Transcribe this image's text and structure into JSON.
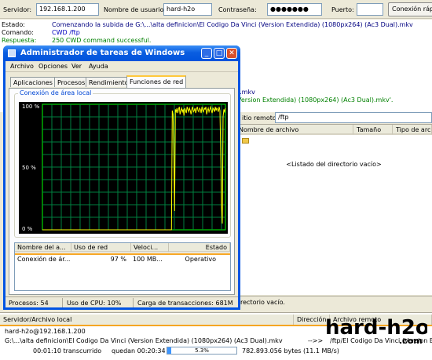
{
  "quickconnect": {
    "server_label": "Servidor:",
    "server_value": "192.168.1.200",
    "user_label": "Nombre de usuario:",
    "user_value": "hard-h2o",
    "password_label": "Contraseña:",
    "password_value": "●●●●●●●",
    "port_label": "Puerto:",
    "port_value": "",
    "connect_button": "Conexión rápida"
  },
  "log": [
    {
      "key": "Estado:",
      "text": "Comenzando la subida de G:\\...\\alta definicion\\El Codigo Da Vinci (Version Extendida) (1080px264) (Ac3 Dual).mkv",
      "kind": "status"
    },
    {
      "key": "Comando:",
      "text": "CWD /ftp",
      "kind": "command"
    },
    {
      "key": "Respuesta:",
      "text": "250 CWD command successful.",
      "kind": "response"
    },
    {
      "key": "",
      "text": ").mkv",
      "kind": "status"
    },
    {
      "key": "",
      "text": "Version Extendida) (1080px264) (Ac3 Dual).mkv'.",
      "kind": "response"
    }
  ],
  "remote": {
    "path_label": "itio remoto:",
    "path_value": "/ftp",
    "columns": [
      "Nombre de archivo",
      "Tamaño",
      "Tipo de archivo"
    ],
    "empty_message": "<Listado del directorio vacío>",
    "status": "rectorio vacío."
  },
  "taskmanager": {
    "title": "Administrador de tareas de Windows",
    "menu": [
      "Archivo",
      "Opciones",
      "Ver",
      "Ayuda"
    ],
    "tabs": [
      "Aplicaciones",
      "Procesos",
      "Rendimiento",
      "Funciones de red"
    ],
    "active_tab": "Funciones de red",
    "group_label": "Conexión de área local",
    "y_labels": [
      "100 %",
      "50 %",
      "0 %"
    ],
    "table_columns": [
      "Nombre del a...",
      "Uso de red",
      "Veloci...",
      "Estado"
    ],
    "table_row": [
      "Conexión de ár...",
      "97 %",
      "100 MB...",
      "Operativo"
    ],
    "status": {
      "processes": "Procesos: 54",
      "cpu": "Uso de CPU: 10%",
      "commit": "Carga de transacciones: 681M"
    }
  },
  "queue": {
    "columns": [
      "Servidor/Archivo local",
      "Dirección",
      "Archivo remoto"
    ],
    "server_row": "hard-h2o@192.168.1.200",
    "file_row": "G:\\...\\alta definicion\\El Codigo Da Vinci (Version Extendida) (1080px264) (Ac3 Dual).mkv",
    "direction": "-->>",
    "remote_file": "/ftp/El Codigo Da Vinci (Version E",
    "elapsed": "00:01:10 transcurrido",
    "remaining": "quedan 00:20:34",
    "progress_label": "5.3%",
    "progress": 0.053,
    "bytes": "782.893.056 bytes (11.1 MB/s)"
  },
  "watermark": "hard-h2o",
  "watermark_sub": ".com",
  "graph_data": {
    "type": "line",
    "ylim": [
      0,
      100
    ],
    "values": [
      0,
      0,
      0,
      0,
      0,
      0,
      0,
      0,
      0,
      0,
      0,
      0,
      0,
      0,
      0,
      0,
      0,
      0,
      0,
      0,
      0,
      0,
      0,
      0,
      0,
      0,
      0,
      0,
      0,
      0,
      0,
      0,
      0,
      0,
      0,
      0,
      0,
      0,
      0,
      0,
      0,
      0,
      0,
      0,
      0,
      0,
      0,
      0,
      0,
      0,
      0,
      0,
      0,
      0,
      0,
      0,
      0,
      0,
      0,
      0,
      0,
      0,
      0,
      0,
      0,
      0,
      0,
      0,
      0,
      0,
      0,
      0,
      0,
      0,
      0,
      0,
      0,
      0,
      0,
      0,
      0,
      0,
      0,
      0,
      0,
      0,
      0,
      0,
      0,
      0,
      0,
      0,
      0,
      0,
      0,
      0,
      0,
      0,
      0,
      0,
      0,
      0,
      0,
      0,
      0,
      0,
      0,
      0,
      0,
      0,
      0,
      0,
      0,
      0,
      0,
      0,
      0,
      0,
      0,
      0,
      0,
      0,
      0,
      0,
      0,
      0,
      0,
      0,
      0,
      0,
      0,
      0,
      0,
      0,
      0,
      0,
      0,
      0,
      0,
      0,
      0,
      0,
      0,
      0,
      0,
      0,
      0,
      0,
      0,
      0,
      0,
      0,
      0,
      0,
      0,
      0,
      0,
      0,
      0,
      0,
      0,
      0,
      0,
      0,
      0,
      0,
      95,
      92,
      60,
      15,
      96,
      94,
      97,
      93,
      96,
      98,
      92,
      95,
      97,
      94,
      96,
      91,
      97,
      95,
      93,
      98,
      96,
      94,
      97,
      95,
      92,
      96,
      98,
      94,
      95,
      97,
      93,
      96,
      98,
      95,
      94,
      97,
      96,
      93,
      98,
      95,
      94,
      97,
      96,
      98,
      92,
      95,
      97,
      94,
      96,
      98,
      95,
      93,
      97,
      96,
      94,
      98,
      95,
      97,
      96,
      94,
      98,
      95,
      60,
      20,
      5,
      90,
      96,
      94,
      97
    ]
  }
}
